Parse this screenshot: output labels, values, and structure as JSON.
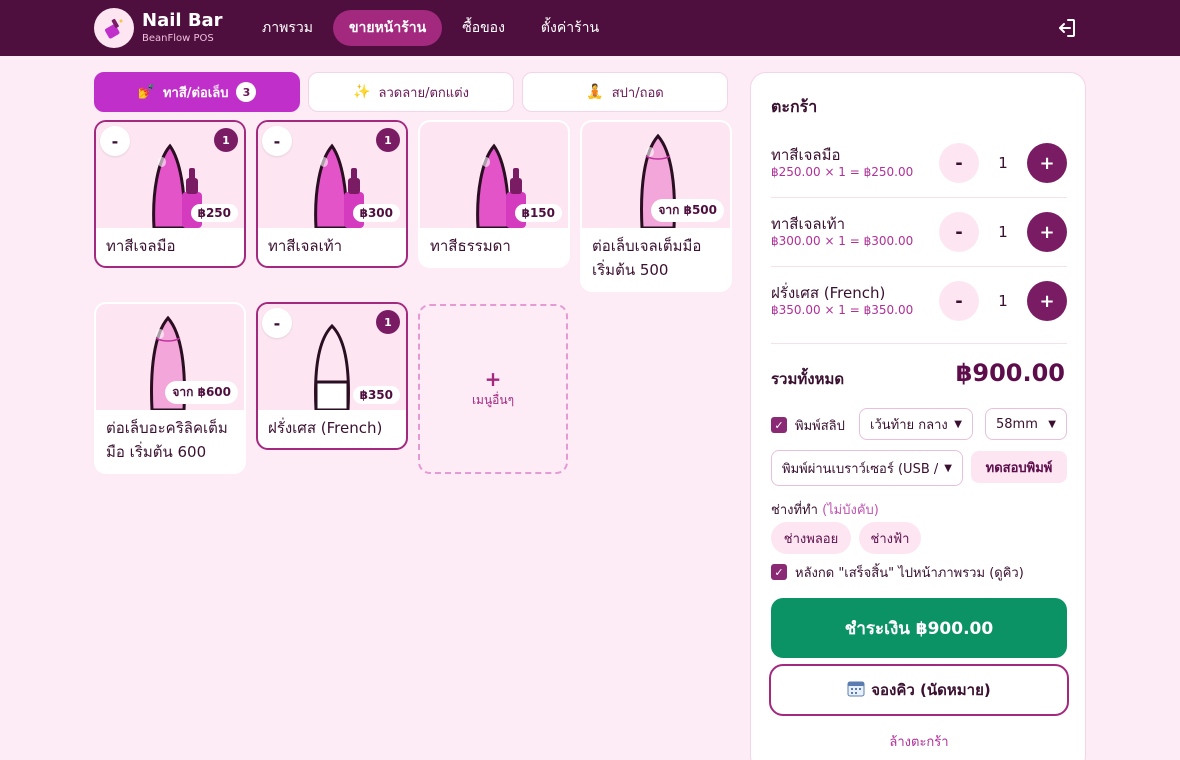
{
  "header": {
    "brand_name": "Nail Bar",
    "brand_sub": "BeanFlow POS",
    "nav": [
      {
        "label": "ภาพรวม"
      },
      {
        "label": "ขายหน้าร้าน"
      },
      {
        "label": "ซื้อของ"
      },
      {
        "label": "ตั้งค่าร้าน"
      }
    ],
    "active_nav": "ขายหน้าร้าน"
  },
  "categories": [
    {
      "icon": "💅",
      "label": "ทาสี/ต่อเล็บ",
      "count": "3"
    },
    {
      "icon": "✨",
      "label": "ลวดลาย/ตกแต่ง"
    },
    {
      "icon": "🧘",
      "label": "สปา/ถอด"
    }
  ],
  "products": [
    {
      "name": "ทาสีเจลมือ",
      "price": "฿250",
      "qty": "1",
      "minus": "-"
    },
    {
      "name": "ทาสีเจลเท้า",
      "price": "฿300",
      "qty": "1",
      "minus": "-"
    },
    {
      "name": "ทาสีธรรมดา",
      "price": "฿150"
    },
    {
      "name": "ต่อเล็บเจลเต็มมือ เริ่มต้น 500",
      "price": "จาก ฿500"
    },
    {
      "name": "ต่อเล็บอะคริลิคเต็มมือ เริ่มต้น 600",
      "price": "จาก ฿600"
    },
    {
      "name": "ฝรั่งเศส (French)",
      "price": "฿350",
      "qty": "1",
      "minus": "-"
    }
  ],
  "add_more": {
    "plus": "+",
    "label": "เมนูอื่นๆ"
  },
  "cart": {
    "title": "ตะกร้า",
    "items": [
      {
        "name": "ทาสีเจลมือ",
        "sub": "฿250.00 × 1 = ฿250.00",
        "qty": "1"
      },
      {
        "name": "ทาสีเจลเท้า",
        "sub": "฿300.00 × 1 = ฿300.00",
        "qty": "1"
      },
      {
        "name": "ฝรั่งเศส (French)",
        "sub": "฿350.00 × 1 = ฿350.00",
        "qty": "1"
      }
    ],
    "minus_label": "-",
    "plus_label": "+",
    "total_label": "รวมทั้งหมด",
    "total_value": "฿900.00",
    "print_label": "พิมพ์สลิป",
    "print_checked": true,
    "margin_select": "เว้นท้าย กลาง",
    "paper_select": "58mm",
    "printer_select": "พิมพ์ผ่านเบราว์เซอร์ (USB /",
    "test_print": "ทดสอบพิมพ์",
    "tech_label": "ช่างที่ทำ",
    "tech_optional": "(ไม่บังคับ)",
    "techs": [
      "ช่างพลอย",
      "ช่างฟ้า"
    ],
    "after_finish_label": "หลังกด \"เสร็จสิ้น\" ไปหน้าภาพรวม (ดูคิว)",
    "after_finish_checked": true,
    "pay_button": "ชำระเงิน ฿900.00",
    "book_button": "จองคิว (นัดหมาย)",
    "clear_link": "ล้างตะกร้า"
  },
  "colors": {
    "header_bg": "#4f0f3e",
    "accent": "#a3297f",
    "active_tab": "#c02fc9",
    "pay": "#0b9366",
    "page_bg": "#fdebf5"
  }
}
